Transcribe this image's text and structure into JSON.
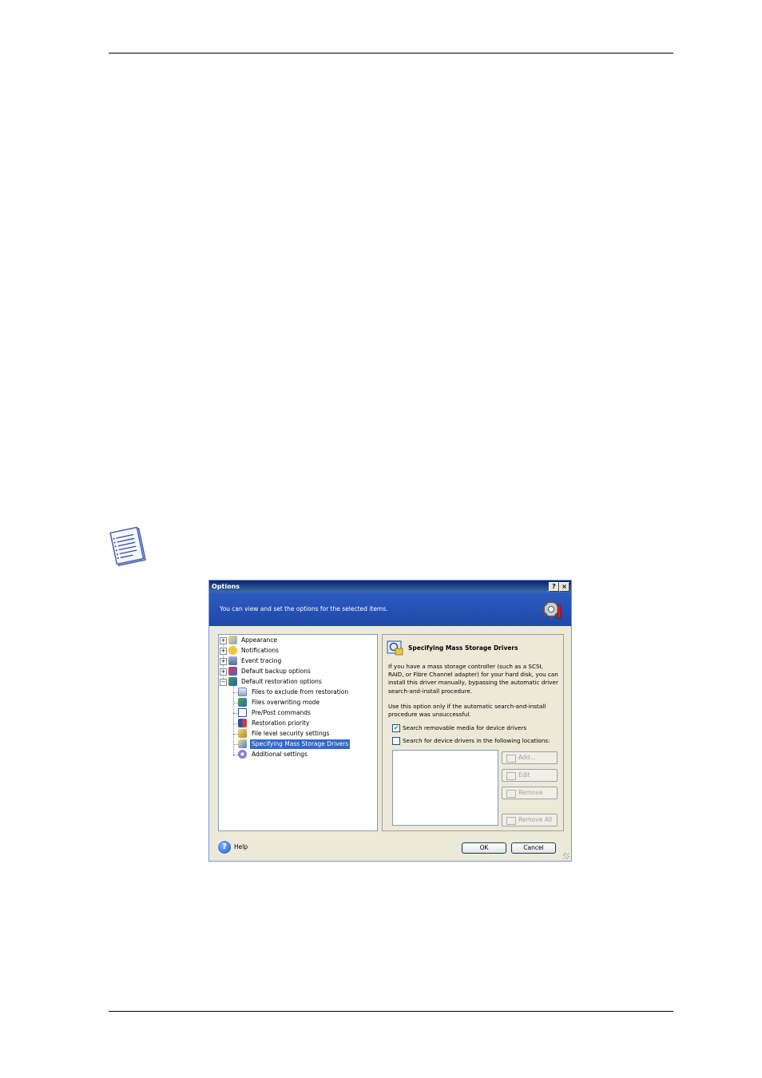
{
  "dialog": {
    "title": "Options",
    "help_button": "?",
    "close_button": "×",
    "banner_text": "You can view and set the options for the selected items.",
    "tree": [
      {
        "label": "Appearance",
        "level": 0,
        "expander": "+"
      },
      {
        "label": "Notifications",
        "level": 0,
        "expander": "+"
      },
      {
        "label": "Event tracing",
        "level": 0,
        "expander": "+"
      },
      {
        "label": "Default backup options",
        "level": 0,
        "expander": "+"
      },
      {
        "label": "Default restoration options",
        "level": 0,
        "expander": "−"
      },
      {
        "label": "Files to exclude from restoration",
        "level": 1
      },
      {
        "label": "Files overwriting mode",
        "level": 1
      },
      {
        "label": "Pre/Post commands",
        "level": 1
      },
      {
        "label": "Restoration priority",
        "level": 1
      },
      {
        "label": "File level security settings",
        "level": 1
      },
      {
        "label": "Specifying Mass Storage Drivers",
        "level": 1,
        "selected": true
      },
      {
        "label": "Additional settings",
        "level": 1
      }
    ],
    "panel": {
      "title": "Specifying Mass Storage Drivers",
      "description_1": "If you have a mass storage controller (such as a SCSI, RAID, or Fibre Channel adapter) for your hard disk, you can install this driver manually, bypassing the automatic driver search-and-install procedure.",
      "description_2": "Use this option only if the automatic search-and-install procedure was unsuccessful.",
      "checkbox_1": {
        "label": "Search removable media for device drivers",
        "checked": true,
        "mark": "✔"
      },
      "checkbox_2": {
        "label": "Search for device drivers in the following locations:",
        "checked": false
      },
      "buttons": {
        "add": "Add...",
        "edit": "Edit",
        "remove": "Remove",
        "remove_all": "Remove All"
      }
    },
    "footer": {
      "help": "Help",
      "help_glyph": "?",
      "ok": "OK",
      "cancel": "Cancel"
    }
  }
}
